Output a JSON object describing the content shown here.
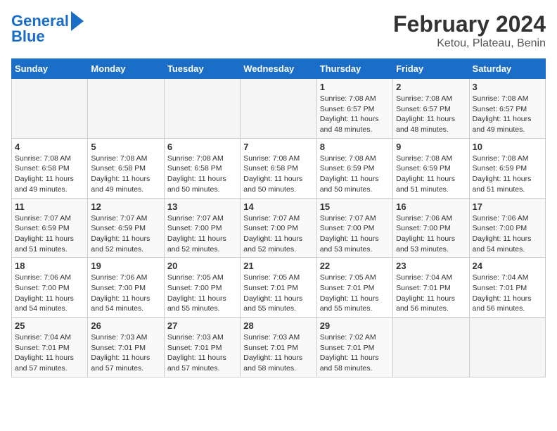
{
  "header": {
    "logo_line1": "General",
    "logo_line2": "Blue",
    "title": "February 2024",
    "subtitle": "Ketou, Plateau, Benin"
  },
  "weekdays": [
    "Sunday",
    "Monday",
    "Tuesday",
    "Wednesday",
    "Thursday",
    "Friday",
    "Saturday"
  ],
  "weeks": [
    [
      {
        "num": "",
        "info": ""
      },
      {
        "num": "",
        "info": ""
      },
      {
        "num": "",
        "info": ""
      },
      {
        "num": "",
        "info": ""
      },
      {
        "num": "1",
        "info": "Sunrise: 7:08 AM\nSunset: 6:57 PM\nDaylight: 11 hours\nand 48 minutes."
      },
      {
        "num": "2",
        "info": "Sunrise: 7:08 AM\nSunset: 6:57 PM\nDaylight: 11 hours\nand 48 minutes."
      },
      {
        "num": "3",
        "info": "Sunrise: 7:08 AM\nSunset: 6:57 PM\nDaylight: 11 hours\nand 49 minutes."
      }
    ],
    [
      {
        "num": "4",
        "info": "Sunrise: 7:08 AM\nSunset: 6:58 PM\nDaylight: 11 hours\nand 49 minutes."
      },
      {
        "num": "5",
        "info": "Sunrise: 7:08 AM\nSunset: 6:58 PM\nDaylight: 11 hours\nand 49 minutes."
      },
      {
        "num": "6",
        "info": "Sunrise: 7:08 AM\nSunset: 6:58 PM\nDaylight: 11 hours\nand 50 minutes."
      },
      {
        "num": "7",
        "info": "Sunrise: 7:08 AM\nSunset: 6:58 PM\nDaylight: 11 hours\nand 50 minutes."
      },
      {
        "num": "8",
        "info": "Sunrise: 7:08 AM\nSunset: 6:59 PM\nDaylight: 11 hours\nand 50 minutes."
      },
      {
        "num": "9",
        "info": "Sunrise: 7:08 AM\nSunset: 6:59 PM\nDaylight: 11 hours\nand 51 minutes."
      },
      {
        "num": "10",
        "info": "Sunrise: 7:08 AM\nSunset: 6:59 PM\nDaylight: 11 hours\nand 51 minutes."
      }
    ],
    [
      {
        "num": "11",
        "info": "Sunrise: 7:07 AM\nSunset: 6:59 PM\nDaylight: 11 hours\nand 51 minutes."
      },
      {
        "num": "12",
        "info": "Sunrise: 7:07 AM\nSunset: 6:59 PM\nDaylight: 11 hours\nand 52 minutes."
      },
      {
        "num": "13",
        "info": "Sunrise: 7:07 AM\nSunset: 7:00 PM\nDaylight: 11 hours\nand 52 minutes."
      },
      {
        "num": "14",
        "info": "Sunrise: 7:07 AM\nSunset: 7:00 PM\nDaylight: 11 hours\nand 52 minutes."
      },
      {
        "num": "15",
        "info": "Sunrise: 7:07 AM\nSunset: 7:00 PM\nDaylight: 11 hours\nand 53 minutes."
      },
      {
        "num": "16",
        "info": "Sunrise: 7:06 AM\nSunset: 7:00 PM\nDaylight: 11 hours\nand 53 minutes."
      },
      {
        "num": "17",
        "info": "Sunrise: 7:06 AM\nSunset: 7:00 PM\nDaylight: 11 hours\nand 54 minutes."
      }
    ],
    [
      {
        "num": "18",
        "info": "Sunrise: 7:06 AM\nSunset: 7:00 PM\nDaylight: 11 hours\nand 54 minutes."
      },
      {
        "num": "19",
        "info": "Sunrise: 7:06 AM\nSunset: 7:00 PM\nDaylight: 11 hours\nand 54 minutes."
      },
      {
        "num": "20",
        "info": "Sunrise: 7:05 AM\nSunset: 7:00 PM\nDaylight: 11 hours\nand 55 minutes."
      },
      {
        "num": "21",
        "info": "Sunrise: 7:05 AM\nSunset: 7:01 PM\nDaylight: 11 hours\nand 55 minutes."
      },
      {
        "num": "22",
        "info": "Sunrise: 7:05 AM\nSunset: 7:01 PM\nDaylight: 11 hours\nand 55 minutes."
      },
      {
        "num": "23",
        "info": "Sunrise: 7:04 AM\nSunset: 7:01 PM\nDaylight: 11 hours\nand 56 minutes."
      },
      {
        "num": "24",
        "info": "Sunrise: 7:04 AM\nSunset: 7:01 PM\nDaylight: 11 hours\nand 56 minutes."
      }
    ],
    [
      {
        "num": "25",
        "info": "Sunrise: 7:04 AM\nSunset: 7:01 PM\nDaylight: 11 hours\nand 57 minutes."
      },
      {
        "num": "26",
        "info": "Sunrise: 7:03 AM\nSunset: 7:01 PM\nDaylight: 11 hours\nand 57 minutes."
      },
      {
        "num": "27",
        "info": "Sunrise: 7:03 AM\nSunset: 7:01 PM\nDaylight: 11 hours\nand 57 minutes."
      },
      {
        "num": "28",
        "info": "Sunrise: 7:03 AM\nSunset: 7:01 PM\nDaylight: 11 hours\nand 58 minutes."
      },
      {
        "num": "29",
        "info": "Sunrise: 7:02 AM\nSunset: 7:01 PM\nDaylight: 11 hours\nand 58 minutes."
      },
      {
        "num": "",
        "info": ""
      },
      {
        "num": "",
        "info": ""
      }
    ]
  ]
}
